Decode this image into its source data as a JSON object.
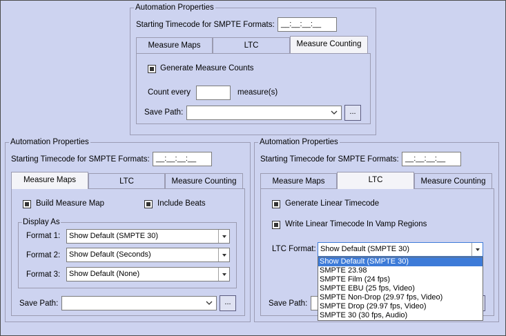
{
  "top": {
    "group_title": "Automation Properties",
    "tc_label": "Starting Timecode for SMPTE Formats:",
    "tc_value": "__:__:__:__",
    "tabs": [
      "Measure Maps",
      "LTC",
      "Measure Counting"
    ],
    "active_tab": "Measure Counting",
    "generate_label": "Generate Measure Counts",
    "count_every_label": "Count every",
    "count_every_value": "",
    "count_unit": "measure(s)",
    "save_path_label": "Save Path:",
    "save_path_value": "",
    "browse_label": "..."
  },
  "left": {
    "group_title": "Automation Properties",
    "tc_label": "Starting Timecode for SMPTE Formats:",
    "tc_value": "__:__:__:__",
    "tabs": [
      "Measure Maps",
      "LTC",
      "Measure Counting"
    ],
    "active_tab": "Measure Maps",
    "build_label": "Build Measure Map",
    "beats_label": "Include Beats",
    "display_as_label": "Display As",
    "format1_label": "Format 1:",
    "format1_value": "Show Default (SMPTE 30)",
    "format2_label": "Format 2:",
    "format2_value": "Show Default (Seconds)",
    "format3_label": "Format 3:",
    "format3_value": "Show Default (None)",
    "save_path_label": "Save Path:",
    "save_path_value": "",
    "browse_label": "..."
  },
  "right": {
    "group_title": "Automation Properties",
    "tc_label": "Starting Timecode for SMPTE Formats:",
    "tc_value": "__:__:__:__",
    "tabs": [
      "Measure Maps",
      "LTC",
      "Measure Counting"
    ],
    "active_tab": "LTC",
    "gen_ltc_label": "Generate Linear Timecode",
    "write_ltc_label": "Write Linear Timecode In Vamp Regions",
    "ltc_format_label": "LTC Format:",
    "ltc_format_value": "Show Default (SMPTE 30)",
    "save_path_label": "Save Path:",
    "ltc_options": [
      "Show Default (SMPTE 30)",
      "SMPTE 23.98",
      "SMPTE Film (24 fps)",
      "SMPTE EBU (25 fps, Video)",
      "SMPTE Non-Drop (29.97 fps, Video)",
      "SMPTE Drop (29.97 fps, Video)",
      "SMPTE 30 (30 fps, Audio)"
    ],
    "ltc_selected_option": "Show Default (SMPTE 30)"
  },
  "colors": {
    "background": "#cdd3f0",
    "tab_active": "#f4f4f8",
    "highlight": "#3d7bd8"
  }
}
